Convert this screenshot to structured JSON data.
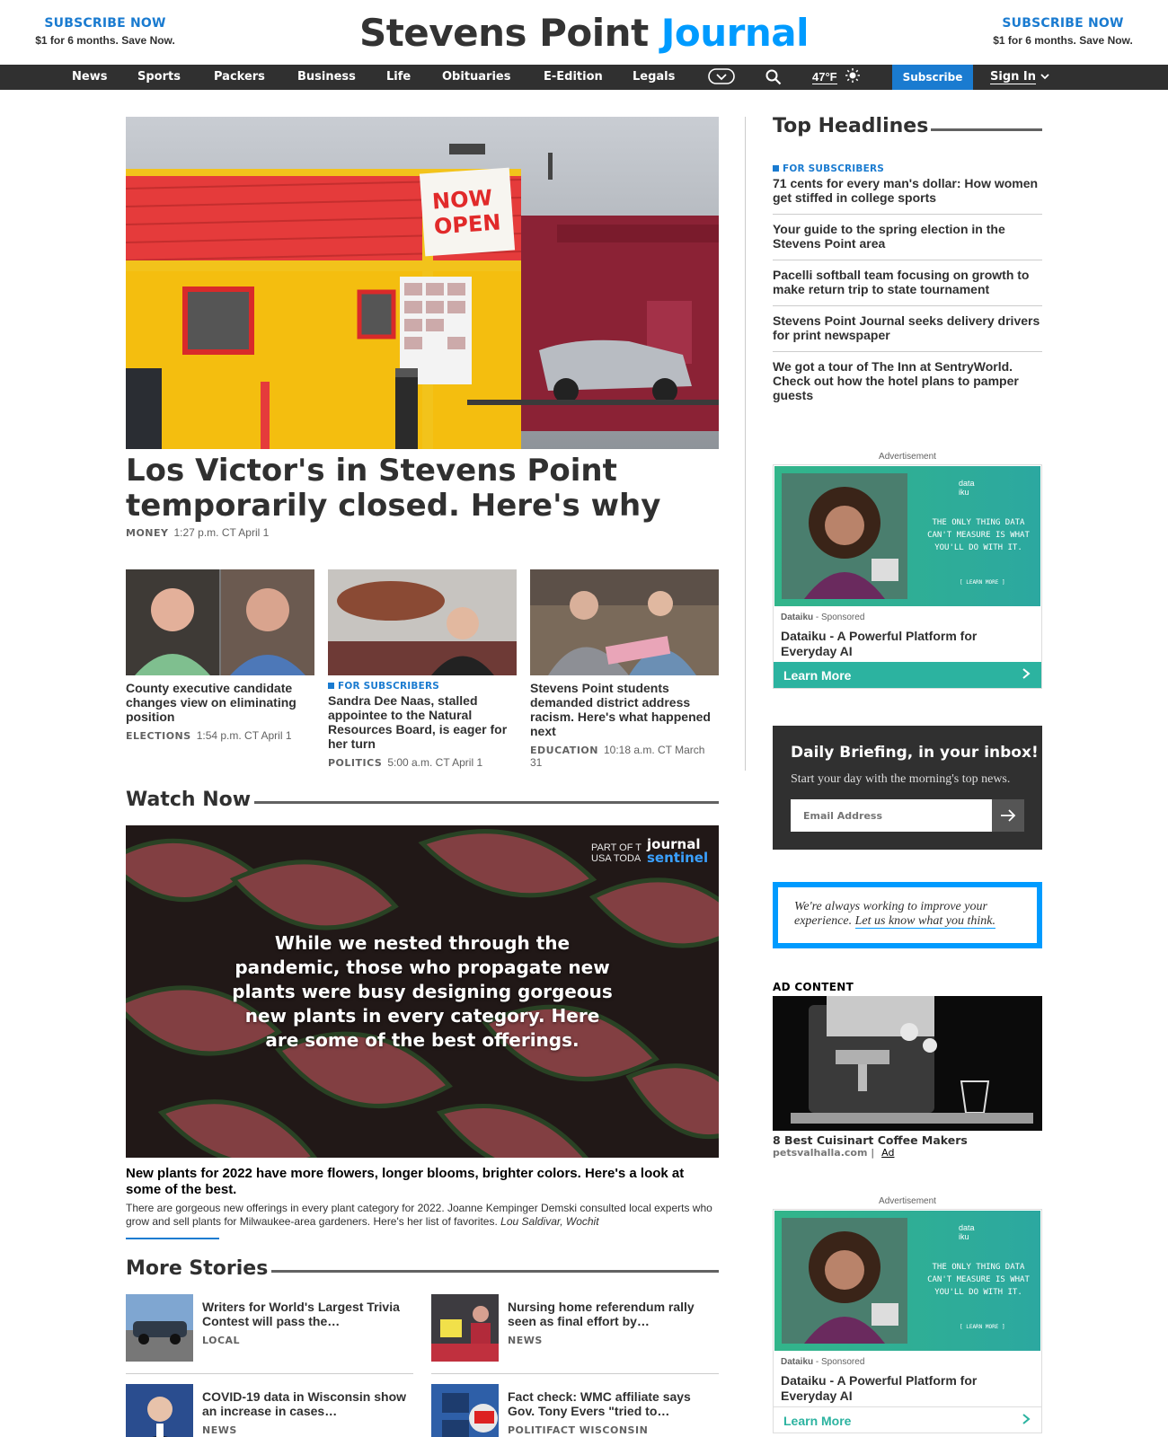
{
  "header": {
    "promo_left": {
      "title": "SUBSCRIBE NOW",
      "subtitle": "$1 for 6 months. Save Now."
    },
    "promo_right": {
      "title": "SUBSCRIBE NOW",
      "subtitle": "$1 for 6 months. Save Now."
    },
    "logo_part1": "Stevens Point ",
    "logo_part2": "Journal"
  },
  "nav": {
    "items": [
      "News",
      "Sports",
      "Packers",
      "Business",
      "Life",
      "Obituaries",
      "E-Edition",
      "Legals"
    ],
    "temperature": "47°F",
    "subscribe": "Subscribe",
    "sign_in": "Sign In",
    "icons": [
      "chevron-circle-icon",
      "search-icon",
      "sun-icon",
      "chevron-down-icon"
    ]
  },
  "hero": {
    "sign_line1": "NOW",
    "sign_line2": "OPEN",
    "title": "Los Victor's in Stevens Point temporarily closed. Here's why",
    "label": "MONEY",
    "time": "1:27 p.m. CT April 1"
  },
  "stories": [
    {
      "headline": "County executive candidate changes view on eliminating position",
      "label": "ELECTIONS",
      "time": "1:54 p.m. CT April 1",
      "subscriber": ""
    },
    {
      "headline": "Sandra Dee Naas, stalled appointee to the Natural Resources Board, is eager for her turn",
      "label": "POLITICS",
      "time": "5:00 a.m. CT April 1",
      "subscriber": "FOR SUBSCRIBERS"
    },
    {
      "headline": "Stevens Point students demanded district address racism. Here's what happened next",
      "label": "EDUCATION",
      "time": "10:18 a.m. CT March 31",
      "subscriber": ""
    }
  ],
  "watch_now": {
    "heading": "Watch Now",
    "overlay": "While we nested through the pandemic, those who propagate new plants were busy designing gorgeous new plants in every category. Here are some of the best offerings.",
    "brand_left": "PART OF T\nUSA TODA",
    "brand_right_1": "journal",
    "brand_right_2": "sentinel",
    "title": "New plants for 2022 have more flowers, longer blooms, brighter colors. Here's a look at some of the best.",
    "description": "There are gorgeous new offerings in every plant category for 2022. Joanne Kempinger Demski consulted local experts who grow and sell plants for Milwaukee-area gardeners. Here's her list of favorites.",
    "credit": "Lou Saldivar, Wochit"
  },
  "more_stories": {
    "heading": "More Stories",
    "items": [
      {
        "headline": "Writers for World's Largest Trivia Contest will pass the…",
        "label": "LOCAL"
      },
      {
        "headline": "Nursing home referendum rally seen as final effort by…",
        "label": "NEWS"
      },
      {
        "headline": "COVID-19 data in Wisconsin show an increase in cases…",
        "label": "NEWS"
      },
      {
        "headline": "Fact check: WMC affiliate says Gov. Tony Evers \"tried to…",
        "label": "POLITIFACT WISCONSIN"
      }
    ]
  },
  "sidebar": {
    "top_headlines": "Top Headlines",
    "headlines": [
      {
        "subscriber": "FOR SUBSCRIBERS",
        "headline": "71 cents for every man's dollar: How women get stiffed in college sports"
      },
      {
        "subscriber": "",
        "headline": "Your guide to the spring election in the Stevens Point area"
      },
      {
        "subscriber": "",
        "headline": "Pacelli softball team focusing on growth to make return trip to state tournament"
      },
      {
        "subscriber": "",
        "headline": "Stevens Point Journal seeks delivery drivers for print newspaper"
      },
      {
        "subscriber": "",
        "headline": "We got a tour of The Inn at SentryWorld. Check out how the hotel plans to pamper guests"
      }
    ],
    "ad_label": "Advertisement",
    "ad": {
      "message": "THE ONLY THING DATA CAN'T MEASURE IS WHAT YOU'LL DO WITH IT.",
      "brand_logo": "data\niku",
      "more": "[ LEARN MORE ]",
      "sponsor": "Dataiku",
      "sponsored": " - Sponsored",
      "title": "Dataiku - A Powerful Platform for Everyday AI",
      "cta": "Learn More"
    },
    "newsletter": {
      "title": "Daily Briefing, in your inbox!",
      "description": "Start your day with the morning's top news.",
      "placeholder": "Email Address"
    },
    "feedback": {
      "text": "We're always working to improve your experience. ",
      "link": "Let us know what you think."
    },
    "ad_content": {
      "heading": "AD CONTENT",
      "title": "8 Best Cuisinart Coffee Makers",
      "source": "petsvalhalla.com",
      "ad": "Ad"
    }
  },
  "colors": {
    "accent_blue": "#1a7bd0",
    "logo_blue": "#009bff",
    "nav_bg": "#303030",
    "ad_green": "#2cb3a0"
  }
}
